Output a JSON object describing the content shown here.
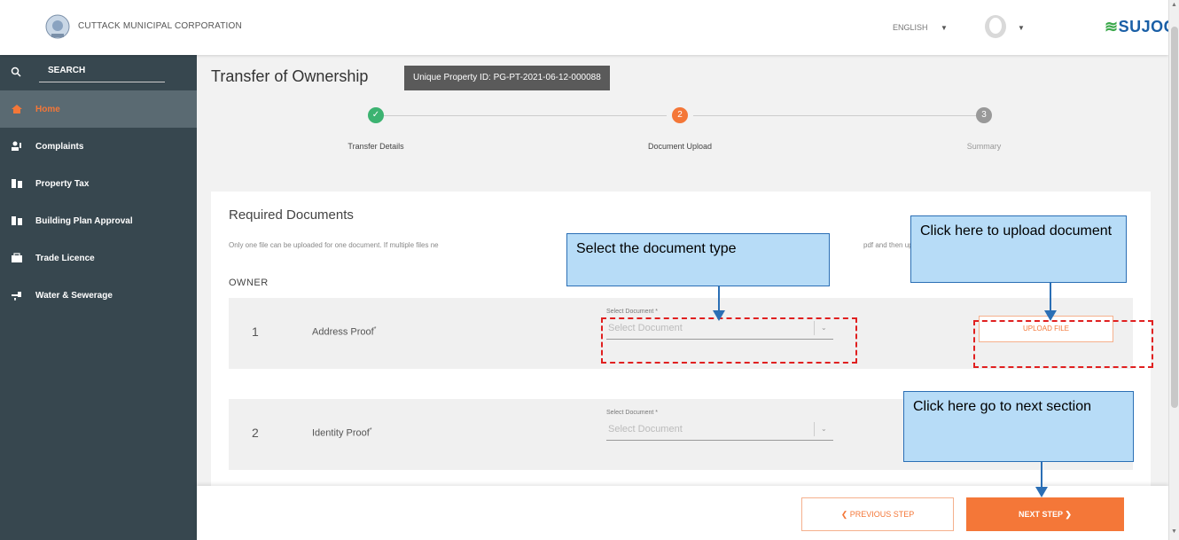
{
  "header": {
    "org_name": "CUTTACK MUNICIPAL CORPORATION",
    "language": "ENGLISH",
    "brand": "SUJOG"
  },
  "sidebar": {
    "search_label": "SEARCH",
    "items": [
      {
        "label": "Home",
        "icon": "home-icon",
        "active": true
      },
      {
        "label": "Complaints",
        "icon": "complaints-icon"
      },
      {
        "label": "Property Tax",
        "icon": "property-tax-icon"
      },
      {
        "label": "Building Plan Approval",
        "icon": "building-icon"
      },
      {
        "label": "Trade Licence",
        "icon": "trade-icon"
      },
      {
        "label": "Water & Sewerage",
        "icon": "water-icon"
      }
    ]
  },
  "main": {
    "title": "Transfer of Ownership",
    "property_id": "Unique Property ID: PG-PT-2021-06-12-000088",
    "steps": [
      {
        "label": "Transfer Details",
        "status": "done",
        "number": "✓"
      },
      {
        "label": "Document Upload",
        "status": "active",
        "number": "2"
      },
      {
        "label": "Summary",
        "status": "pending",
        "number": "3"
      }
    ],
    "card": {
      "title": "Required Documents",
      "note": "Only one file can be uploaded for one document. If multiple files ne",
      "note_tail": "pdf and then upl",
      "section": "OWNER",
      "documents": [
        {
          "number": "1",
          "name": "Address Proof",
          "select_label": "Select Document *",
          "select_value": "Select Document",
          "upload_label": "UPLOAD FILE"
        },
        {
          "number": "2",
          "name": "Identity Proof",
          "select_label": "Select Document *",
          "select_value": "Select Document"
        }
      ]
    }
  },
  "actions": {
    "previous": "❮  PREVIOUS STEP",
    "next": "NEXT STEP  ❯"
  },
  "annotations": {
    "select_doc": "Select the document type",
    "upload_doc": "Click here to upload document",
    "next_section": "Click here go to next section"
  },
  "colors": {
    "accent": "#f47738",
    "sidebar": "#37474f",
    "done": "#3cb371",
    "callout": "#b7dcf7"
  }
}
